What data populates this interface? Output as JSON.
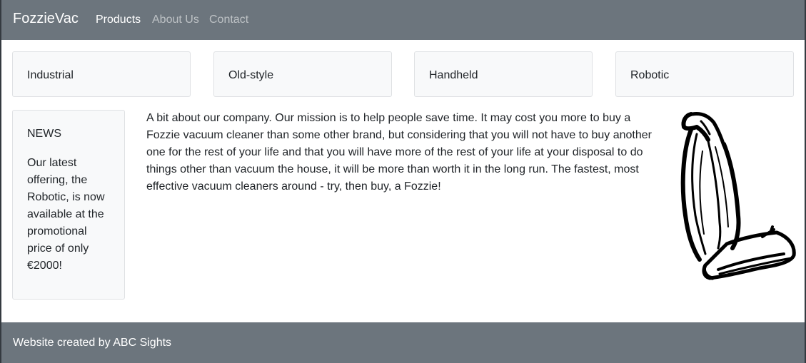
{
  "navbar": {
    "brand": "FozzieVac",
    "links": [
      {
        "label": "Products",
        "active": true
      },
      {
        "label": "About Us",
        "active": false
      },
      {
        "label": "Contact",
        "active": false
      }
    ]
  },
  "categories": [
    {
      "label": "Industrial"
    },
    {
      "label": "Old-style"
    },
    {
      "label": "Handheld"
    },
    {
      "label": "Robotic"
    }
  ],
  "news": {
    "title": "NEWS",
    "text": "Our latest offering, the Robotic, is now available at the promotional price of only €2000!"
  },
  "about": {
    "text": "A bit about our company. Our mission is to help people save time. It may cost you more to buy a Fozzie vacuum cleaner than some other brand, but considering that you will not have to buy another one for the rest of your life and that you will have more of the rest of your life at your disposal to do things other than vacuum the house, it will be more than worth it in the long run. The fastest, most effective vacuum cleaners around - try, then buy, a Fozzie!"
  },
  "image": {
    "icon": "vacuum-cleaner-sketch"
  },
  "footer": {
    "text": "Website created by ABC Sights"
  },
  "colors": {
    "navbar_bg": "#6c757d",
    "card_bg": "#f8f9fa",
    "text": "#212529"
  }
}
